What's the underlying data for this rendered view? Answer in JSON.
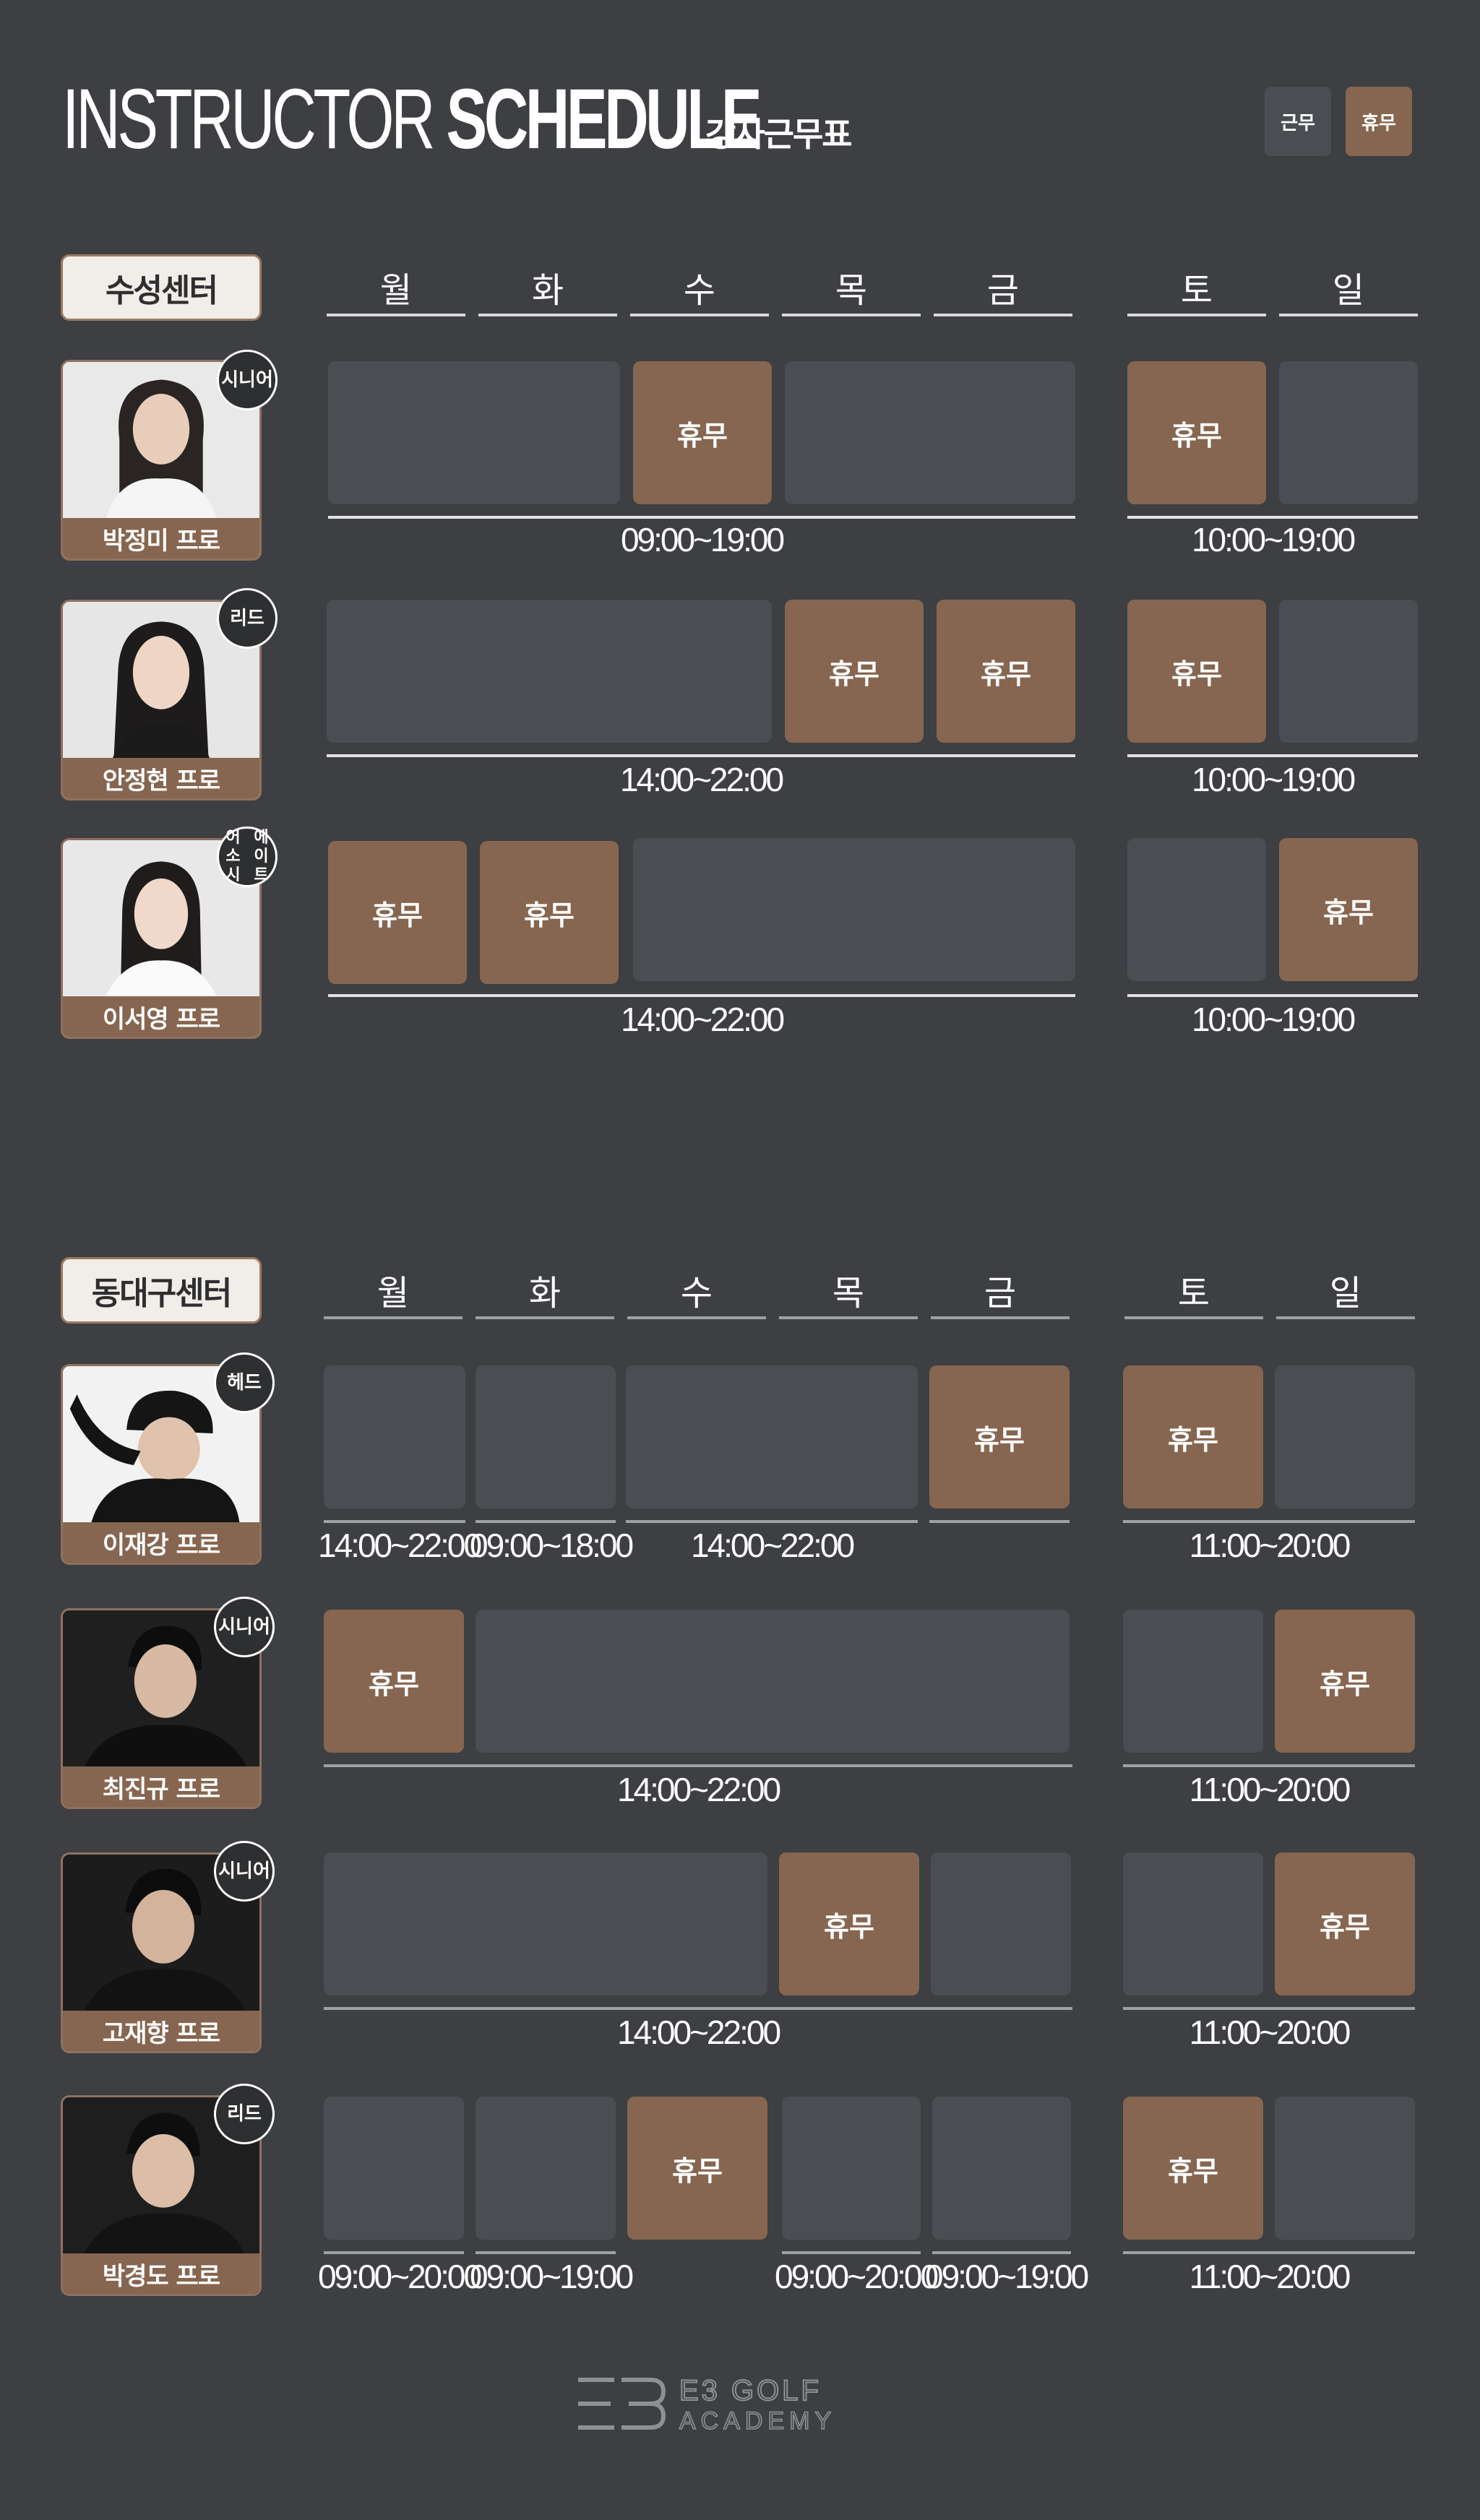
{
  "header": {
    "title_light": "INSTRUCTOR",
    "title_bold": "SCHEDULE",
    "title_ko": "강사근무표"
  },
  "legend": {
    "work": "근무",
    "off": "휴무"
  },
  "days": [
    "월",
    "화",
    "수",
    "목",
    "금",
    "토",
    "일"
  ],
  "off_label": "휴무",
  "sections": [
    {
      "center": "수성센터",
      "instructors": [
        {
          "name": "박정미 프로",
          "rank": "시니어",
          "weekday_hours": "09:00~19:00",
          "weekend_hours": "10:00~19:00"
        },
        {
          "name": "안정현 프로",
          "rank": "리드",
          "weekday_hours": "14:00~22:00",
          "weekend_hours": "10:00~19:00"
        },
        {
          "name": "이서영 프로",
          "rank_line1": "어소시",
          "rank_line2": "에이트",
          "weekday_hours": "14:00~22:00",
          "weekend_hours": "10:00~19:00"
        }
      ]
    },
    {
      "center": "동대구센터",
      "instructors": [
        {
          "name": "이재강 프로",
          "rank": "헤드",
          "hours": [
            "14:00~22:00",
            "09:00~18:00",
            "14:00~22:00"
          ],
          "weekend_hours": "11:00~20:00"
        },
        {
          "name": "최진규 프로",
          "rank": "시니어",
          "weekday_hours": "14:00~22:00",
          "weekend_hours": "11:00~20:00"
        },
        {
          "name": "고재향 프로",
          "rank": "시니어",
          "weekday_hours": "14:00~22:00",
          "weekend_hours": "11:00~20:00"
        },
        {
          "name": "박경도 프로",
          "rank": "리드",
          "hours": [
            "09:00~20:00",
            "09:00~19:00",
            "09:00~20:00",
            "09:00~19:00"
          ],
          "weekend_hours": "11:00~20:00"
        }
      ]
    }
  ],
  "colors": {
    "background": "#3d3f42",
    "work_cell": "#4a4e52",
    "off_cell": "#866650"
  },
  "footer": {
    "logo_line1": "E3 GOLF",
    "logo_line2": "ACADEMY"
  }
}
